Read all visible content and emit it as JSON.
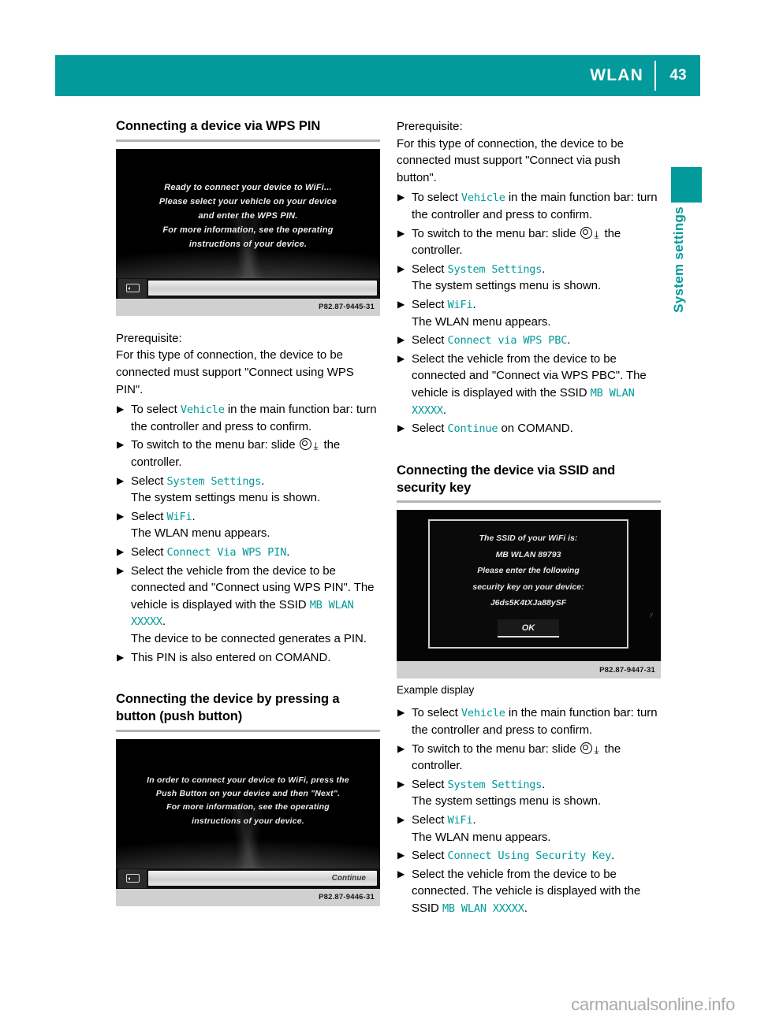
{
  "header": {
    "title": "WLAN",
    "page_number": "43",
    "accent_color": "#029a9a"
  },
  "side_tab": {
    "label": "System settings"
  },
  "left_column": {
    "heading": "Connecting a device via WPS PIN",
    "screenshot": {
      "lines": [
        "Ready to connect your device to WiFi...",
        "Please select your vehicle on your device",
        "and enter the WPS PIN.",
        "For more information, see the operating",
        "instructions of your device."
      ],
      "back_icon": "back-arrow-icon",
      "bar_label": "",
      "image_id": "P82.87-9445-31"
    },
    "prereq_label": "Prerequisite:",
    "prereq_text": "For this type of connection, the device to be connected must support \"Connect using WPS PIN\".",
    "steps": [
      {
        "prefix": "To select ",
        "cmd": "Vehicle",
        "suffix": " in the main function bar: turn the controller and press to confirm."
      },
      {
        "prefix": "To switch to the menu bar: slide ",
        "icon": "controller-icon",
        "suffix": " the controller."
      },
      {
        "prefix": "Select ",
        "cmd": "System Settings",
        "suffix": ".",
        "sub": "The system settings menu is shown."
      },
      {
        "prefix": "Select ",
        "cmd": "WiFi",
        "suffix": ".",
        "sub": "The WLAN menu appears."
      },
      {
        "prefix": "Select ",
        "cmd": "Connect Via WPS PIN",
        "suffix": "."
      },
      {
        "prefix": "Select the vehicle from the device to be connected and \"Connect using WPS PIN\". The vehicle is displayed with the SSID ",
        "cmd": "MB WLAN XXXXX",
        "suffix": ".",
        "sub": "The device to be connected generates a PIN."
      },
      {
        "prefix": "This PIN is also entered on COMAND."
      }
    ],
    "heading2_line1": "Connecting the device by pressing a",
    "heading2_line2": "button (push button)",
    "screenshot2": {
      "lines": [
        "In order to connect your device to WiFi, press the",
        "Push Button on your device and then \"Next\".",
        "For more information, see the operating",
        "instructions of your device."
      ],
      "back_icon": "back-arrow-icon",
      "bar_label": "Continue",
      "image_id": "P82.87-9446-31"
    }
  },
  "right_column": {
    "prereq_label": "Prerequisite:",
    "prereq_text": "For this type of connection, the device to be connected must support \"Connect via push button\".",
    "steps": [
      {
        "prefix": "To select ",
        "cmd": "Vehicle",
        "suffix": " in the main function bar: turn the controller and press to confirm."
      },
      {
        "prefix": "To switch to the menu bar: slide ",
        "icon": "controller-icon",
        "suffix": " the controller."
      },
      {
        "prefix": "Select ",
        "cmd": "System Settings",
        "suffix": ".",
        "sub": "The system settings menu is shown."
      },
      {
        "prefix": "Select ",
        "cmd": "WiFi",
        "suffix": ".",
        "sub": "The WLAN menu appears."
      },
      {
        "prefix": "Select ",
        "cmd": "Connect via WPS PBC",
        "suffix": "."
      },
      {
        "prefix": "Select the vehicle from the device to be connected and \"Connect via WPS PBC\". The vehicle is displayed with the SSID ",
        "cmd": "MB WLAN XXXXX",
        "suffix": "."
      },
      {
        "prefix": "Select ",
        "cmd": "Continue",
        "suffix": " on COMAND."
      }
    ],
    "heading": "Connecting the device via SSID and security key",
    "screenshot": {
      "dialog_lines": [
        "The SSID of your WiFi is:",
        "MB WLAN 89793",
        "Please enter the following",
        "security key on your device:",
        "J6ds5K4tXJa88ySF"
      ],
      "ok_label": "OK",
      "ghost_left": "",
      "ghost_right": "y",
      "image_id": "P82.87-9447-31"
    },
    "example_caption": "Example display",
    "steps2": [
      {
        "prefix": "To select ",
        "cmd": "Vehicle",
        "suffix": " in the main function bar: turn the controller and press to confirm."
      },
      {
        "prefix": "To switch to the menu bar: slide ",
        "icon": "controller-icon",
        "suffix": " the controller."
      },
      {
        "prefix": "Select ",
        "cmd": "System Settings",
        "suffix": ".",
        "sub": "The system settings menu is shown."
      },
      {
        "prefix": "Select ",
        "cmd": "WiFi",
        "suffix": ".",
        "sub": "The WLAN menu appears."
      },
      {
        "prefix": "Select ",
        "cmd": "Connect Using Security Key",
        "suffix": "."
      },
      {
        "prefix": "Select the vehicle from the device to be connected. The vehicle is displayed with the SSID ",
        "cmd": "MB WLAN XXXXX",
        "suffix": "."
      }
    ]
  },
  "footer": {
    "watermark": "carmanualsonline.info"
  }
}
